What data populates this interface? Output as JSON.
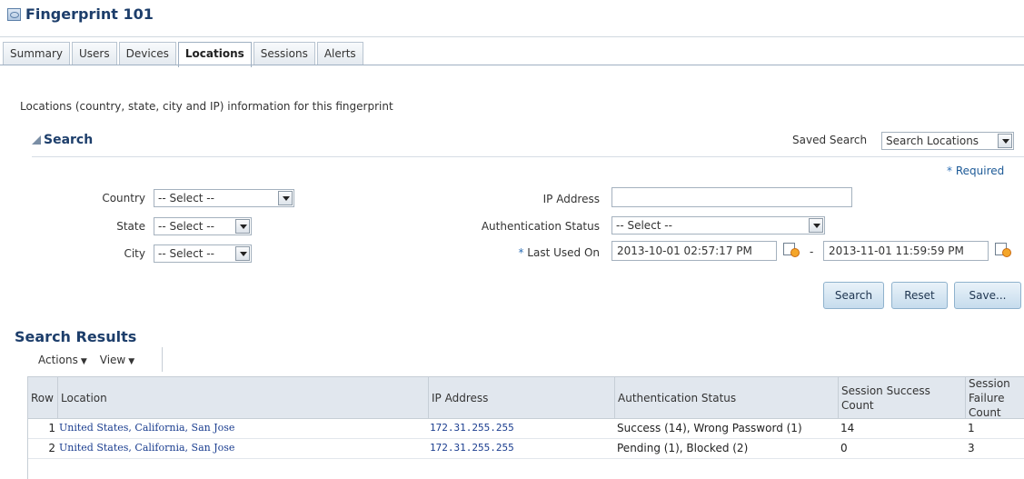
{
  "page": {
    "title": "Fingerprint 101"
  },
  "tabs": [
    "Summary",
    "Users",
    "Devices",
    "Locations",
    "Sessions",
    "Alerts"
  ],
  "active_tab": "Locations",
  "description": "Locations (country, state, city and IP) information for this fingerprint",
  "search": {
    "header": "Search",
    "saved_search_label": "Saved Search",
    "saved_search_value": "Search Locations",
    "required_star": "*",
    "required_label": "Required",
    "country_label": "Country",
    "country_value": "-- Select --",
    "state_label": "State",
    "state_value": "-- Select --",
    "city_label": "City",
    "city_value": "-- Select --",
    "ip_label": "IP Address",
    "ip_value": "",
    "auth_label": "Authentication Status",
    "auth_value": "-- Select --",
    "last_used_star": "*",
    "last_used_label": "Last Used On",
    "last_used_from": "2013-10-01 02:57:17 PM",
    "last_used_sep": "-",
    "last_used_to": "2013-11-01 11:59:59 PM",
    "buttons": {
      "search": "Search",
      "reset": "Reset",
      "save": "Save..."
    }
  },
  "results": {
    "title": "Search Results",
    "actions_label": "Actions",
    "view_label": "View",
    "columns": [
      "Row",
      "Location",
      "IP Address",
      "Authentication Status",
      "Session Success Count",
      "Session Failure Count"
    ],
    "rows": [
      {
        "row": "1",
        "location": "United States, California, San Jose",
        "ip": "172.31.255.255",
        "auth": "Success (14), Wrong Password (1)",
        "success": "14",
        "failure": "1"
      },
      {
        "row": "2",
        "location": "United States, California, San Jose",
        "ip": "172.31.255.255",
        "auth": "Pending (1), Blocked (2)",
        "success": "0",
        "failure": "3"
      }
    ]
  },
  "icons": {
    "title": "fingerprint-page-icon",
    "calendar": "calendar-clock-icon",
    "collapse": "collapse-triangle-icon"
  },
  "colors": {
    "heading": "#1d3e6b",
    "link": "#1a3d8f",
    "button_bg": "#c6dced",
    "header_bg": "#e1e7ee"
  }
}
